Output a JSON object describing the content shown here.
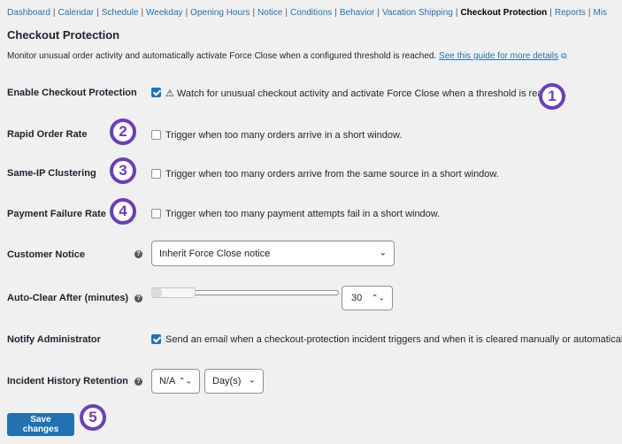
{
  "nav": {
    "items": [
      "Dashboard",
      "Calendar",
      "Schedule",
      "Weekday",
      "Opening Hours",
      "Notice",
      "Conditions",
      "Behavior",
      "Vacation Shipping",
      "Checkout Protection",
      "Reports",
      "Mis"
    ],
    "current": "Checkout Protection"
  },
  "page": {
    "title": "Checkout Protection",
    "description": "Monitor unusual order activity and automatically activate Force Close when a configured threshold is reached.",
    "guide_link": "See this guide for more details"
  },
  "fields": {
    "enable": {
      "label": "Enable Checkout Protection",
      "checked": true,
      "text": "⚠ Watch for unusual checkout activity and activate Force Close when a threshold is reached."
    },
    "rapid": {
      "label": "Rapid Order Rate",
      "checked": false,
      "text": "Trigger when too many orders arrive in a short window."
    },
    "same_ip": {
      "label": "Same-IP Clustering",
      "checked": false,
      "text": "Trigger when too many orders arrive from the same source in a short window."
    },
    "payment": {
      "label": "Payment Failure Rate",
      "checked": false,
      "text": "Trigger when too many payment attempts fail in a short window."
    },
    "notice": {
      "label": "Customer Notice",
      "value": "Inherit Force Close notice"
    },
    "autoclear": {
      "label": "Auto-Clear After (minutes)",
      "value": "30"
    },
    "notify": {
      "label": "Notify Administrator",
      "checked": true,
      "text": "Send an email when a checkout-protection incident triggers and when it is cleared manually or automatically."
    },
    "history": {
      "label": "Incident History Retention",
      "amount": "N/A",
      "unit": "Day(s)"
    }
  },
  "save_label": "Save changes",
  "markers": [
    "1",
    "2",
    "3",
    "4",
    "5"
  ],
  "colors": {
    "accent": "#2271b1",
    "marker": "#6c3fb5",
    "background": "#f0f0f1"
  }
}
